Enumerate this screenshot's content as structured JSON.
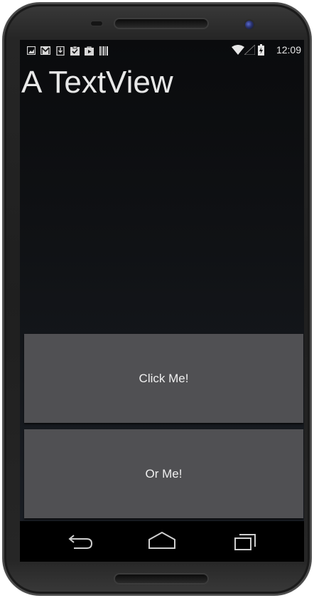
{
  "status_bar": {
    "time": "12:09",
    "notification_icons": [
      "image-icon",
      "gmail-icon",
      "download-icon",
      "clipboard-check-icon",
      "play-store-icon",
      "barcode-icon"
    ],
    "system_icons": [
      "wifi-icon",
      "signal-icon",
      "battery-charging-icon"
    ]
  },
  "main": {
    "text_view": "A TextView",
    "button_one_label": "Click Me!",
    "button_two_label": "Or Me!"
  },
  "nav_bar": {
    "buttons": [
      "back-icon",
      "home-icon",
      "recents-icon"
    ]
  },
  "colors": {
    "screen_background": "#101215",
    "button_background": "#505053",
    "text": "#e8e8e8"
  }
}
